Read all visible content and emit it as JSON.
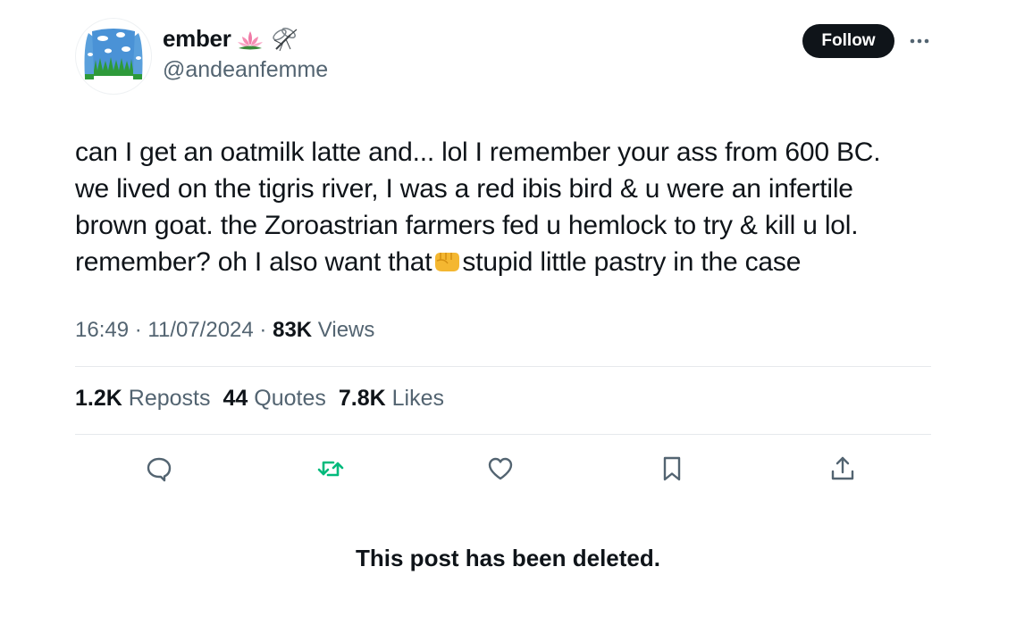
{
  "author": {
    "display_name": "ember",
    "handle": "@andeanfemme",
    "name_emojis": [
      "lotus-emoji",
      "mosquito-emoji"
    ],
    "avatar_icon": "sweater-icon"
  },
  "follow_label": "Follow",
  "more_icon": "more-icon",
  "tweet": {
    "text_before_emoji": "can I get an oatmilk latte and... lol I remember your ass from 600 BC.\nwe lived on the tigris river, I was a red ibis bird & u were an infertile\nbrown goat. the Zoroastrian farmers fed u hemlock to try & kill u lol.\nremember? oh I also want that",
    "inline_emoji": "fist-emoji",
    "text_after_emoji": "stupid little pastry in the case"
  },
  "meta": {
    "time": "16:49",
    "date": "11/07/2024",
    "views_count": "83K",
    "views_label": "Views"
  },
  "stats": {
    "reposts_count": "1.2K",
    "reposts_label": "Reposts",
    "quotes_count": "44",
    "quotes_label": "Quotes",
    "likes_count": "7.8K",
    "likes_label": "Likes"
  },
  "actions": [
    "reply-icon",
    "repost-icon",
    "like-icon",
    "bookmark-icon",
    "share-icon"
  ],
  "colors": {
    "text": "#0f1419",
    "secondary": "#536471",
    "repost_green": "#00ba7c",
    "divider": "#e6e9ec"
  },
  "deleted_notice": "This post has been deleted."
}
